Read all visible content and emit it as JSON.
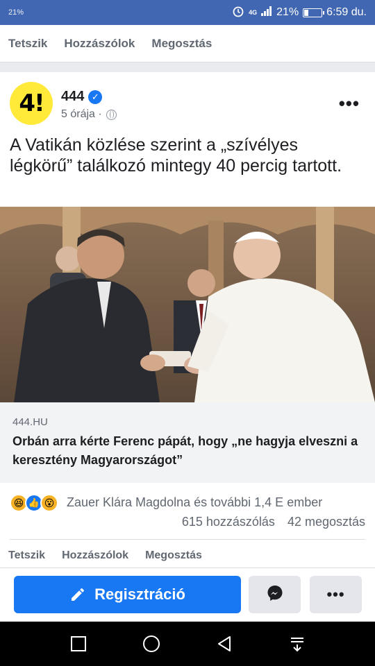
{
  "status_bar": {
    "left_text": "21%",
    "icons": [
      "alarm-icon",
      "4g-icon",
      "signal-icon"
    ],
    "battery": "21%",
    "battery_level": 0.21,
    "time": "6:59 du."
  },
  "top_actions": {
    "like": "Tetszik",
    "comment": "Hozzászólok",
    "share": "Megosztás"
  },
  "post": {
    "avatar_text": "4!",
    "page_name": "444",
    "time": "5 órája ·",
    "text": "A Vatikán közlése szerint a „szívélyes légkörű” találkozó mintegy 40 percig tartott.",
    "link": {
      "domain": "444.HU",
      "title": "Orbán arra kérte Ferenc pápát, hogy „ne hagyja elveszni a keresztény Magyarországot”"
    },
    "reactions": {
      "icons": [
        "haha-icon",
        "like-icon",
        "wow-icon"
      ],
      "names": "Zauer Klára Magdolna és további 1,4 E ember",
      "comments": "615 hozzászólás",
      "shares": "42 megosztás"
    }
  },
  "bottom_actions": {
    "like": "Tetszik",
    "comment": "Hozzászólok",
    "share": "Megosztás"
  },
  "footer": {
    "register_label": "Regisztráció",
    "more_label": "•••"
  },
  "colors": {
    "accent": "#1877f2",
    "status_bar": "#4267b2",
    "avatar_bg": "#ffea3a"
  }
}
